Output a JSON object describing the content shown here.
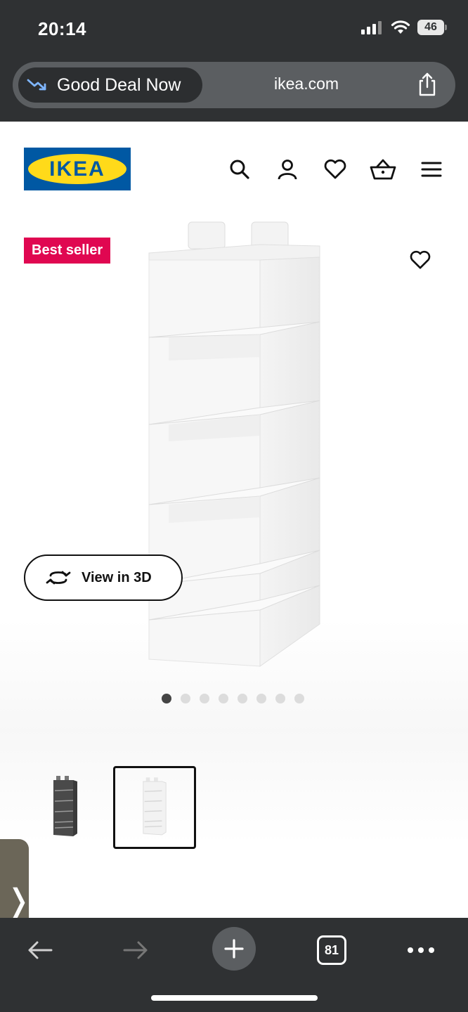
{
  "status_bar": {
    "time": "20:14",
    "battery": "46"
  },
  "address_bar": {
    "deal_label": "Good Deal Now",
    "url": "ikea.com"
  },
  "site": {
    "logo_text": "IKEA",
    "nav_icons": [
      "search-icon",
      "account-icon",
      "heart-icon",
      "basket-icon",
      "menu-icon"
    ]
  },
  "product": {
    "badge": "Best seller",
    "view_3d_label": "View in 3D",
    "carousel": {
      "total": 8,
      "active_index": 0
    },
    "thumbnails": [
      {
        "name": "dark-grey-organizer",
        "selected": false
      },
      {
        "name": "white-organizer",
        "selected": true
      }
    ]
  },
  "toolbar": {
    "tab_count": "81"
  },
  "colors": {
    "chrome": "#2f3133",
    "ikea_blue": "#0058a3",
    "ikea_yellow": "#ffda1a",
    "badge_red": "#e00751"
  }
}
